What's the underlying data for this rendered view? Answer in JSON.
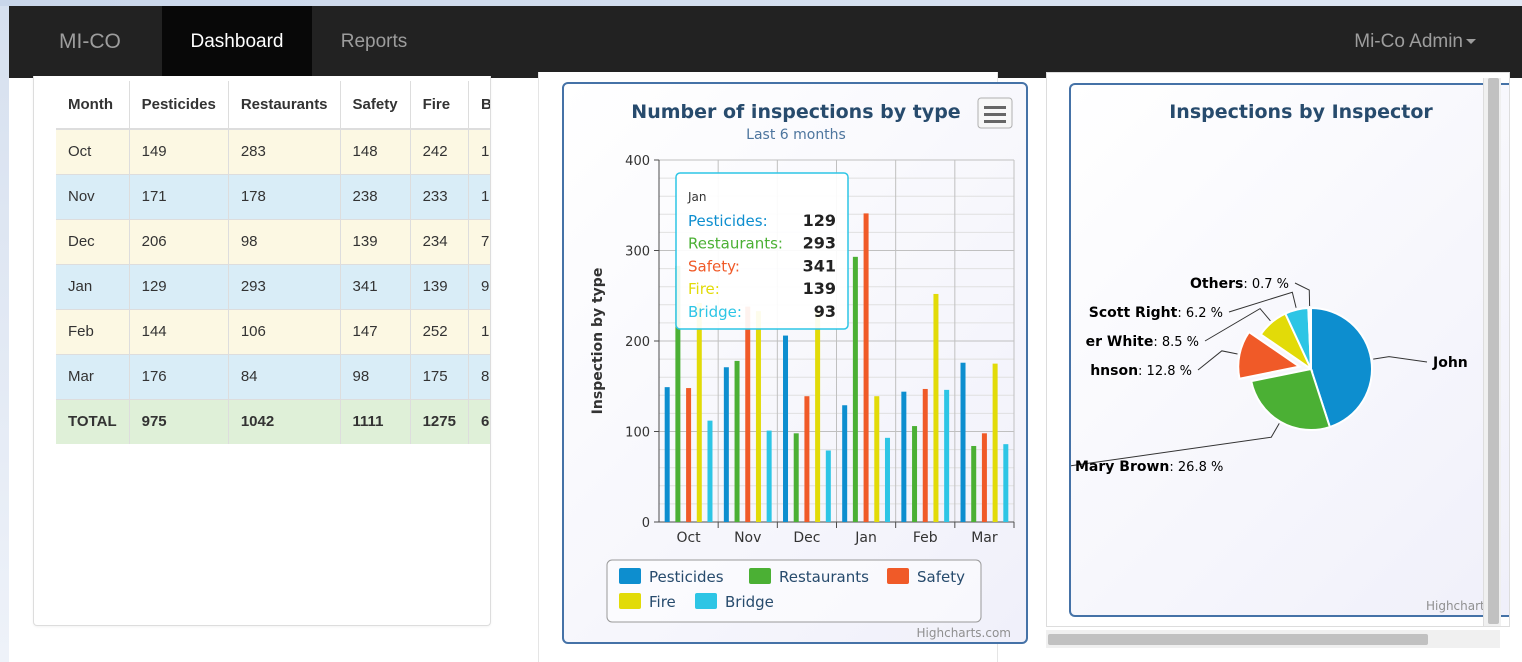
{
  "navbar": {
    "brand": "MI-CO",
    "active_tab": "Dashboard",
    "tab_reports": "Reports",
    "user_menu": "Mi-Co Admin"
  },
  "table": {
    "headers": [
      "Month",
      "Pesticides",
      "Restaurants",
      "Safety",
      "Fire",
      "B"
    ],
    "rows": [
      [
        "Oct",
        "149",
        "283",
        "148",
        "242",
        "1"
      ],
      [
        "Nov",
        "171",
        "178",
        "238",
        "233",
        "1"
      ],
      [
        "Dec",
        "206",
        "98",
        "139",
        "234",
        "7"
      ],
      [
        "Jan",
        "129",
        "293",
        "341",
        "139",
        "9"
      ],
      [
        "Feb",
        "144",
        "106",
        "147",
        "252",
        "1"
      ],
      [
        "Mar",
        "176",
        "84",
        "98",
        "175",
        "8"
      ]
    ],
    "total": [
      "TOTAL",
      "975",
      "1042",
      "1111",
      "1275",
      "6"
    ]
  },
  "chart_data": [
    {
      "type": "bar",
      "title": "Number of inspections by type",
      "subtitle": "Last 6 months",
      "ylabel": "Inspection by type",
      "xlabel": "",
      "ylim": [
        0,
        400
      ],
      "yticks": [
        "0",
        "100",
        "200",
        "300",
        "400"
      ],
      "categories": [
        "Oct",
        "Nov",
        "Dec",
        "Jan",
        "Feb",
        "Mar"
      ],
      "series": [
        {
          "name": "Pesticides",
          "color": "#0d8ecf",
          "values": [
            149,
            171,
            206,
            129,
            144,
            176
          ]
        },
        {
          "name": "Restaurants",
          "color": "#4bb034",
          "values": [
            283,
            178,
            98,
            293,
            106,
            84
          ]
        },
        {
          "name": "Safety",
          "color": "#f05a28",
          "values": [
            148,
            238,
            139,
            341,
            147,
            98
          ]
        },
        {
          "name": "Fire",
          "color": "#e2db08",
          "values": [
            242,
            233,
            234,
            139,
            252,
            175
          ]
        },
        {
          "name": "Bridge",
          "color": "#2dc5e5",
          "values": [
            112,
            101,
            79,
            93,
            146,
            86
          ]
        }
      ],
      "legend": "bottom",
      "tooltip": {
        "title": "Jan",
        "rows": [
          {
            "label": "Pesticides:",
            "value": "129",
            "color": "#0d8ecf"
          },
          {
            "label": "Restaurants:",
            "value": "293",
            "color": "#4bb034"
          },
          {
            "label": "Safety:",
            "value": "341",
            "color": "#f05a28"
          },
          {
            "label": "Fire:",
            "value": "139",
            "color": "#e2db08"
          },
          {
            "label": "Bridge:",
            "value": "93",
            "color": "#2dc5e5"
          }
        ]
      },
      "credits": "Highcharts.com"
    },
    {
      "type": "pie",
      "title": "Inspections by Inspector",
      "slices": [
        {
          "name": "John",
          "value": 45.0,
          "label_value": "",
          "color": "#0d8ecf"
        },
        {
          "name": "Mary Brown",
          "value": 26.8,
          "label_value": ": 26.8 %",
          "color": "#4bb034"
        },
        {
          "name": "hnson",
          "value": 12.8,
          "label_value": ": 12.8 %",
          "color": "#f05a28",
          "sliced": true
        },
        {
          "name": "er White",
          "value": 8.5,
          "label_value": ": 8.5 %",
          "color": "#e2db08"
        },
        {
          "name": "Scott Right",
          "value": 6.2,
          "label_value": ": 6.2 %",
          "color": "#2dc5e5"
        },
        {
          "name": "Others",
          "value": 0.7,
          "label_value": ": 0.7 %",
          "color": "#ffffff"
        }
      ],
      "credits": "Highcharts"
    }
  ],
  "icons": {
    "export_menu": "hamburger-menu-icon",
    "user_caret": "caret-down-icon"
  }
}
